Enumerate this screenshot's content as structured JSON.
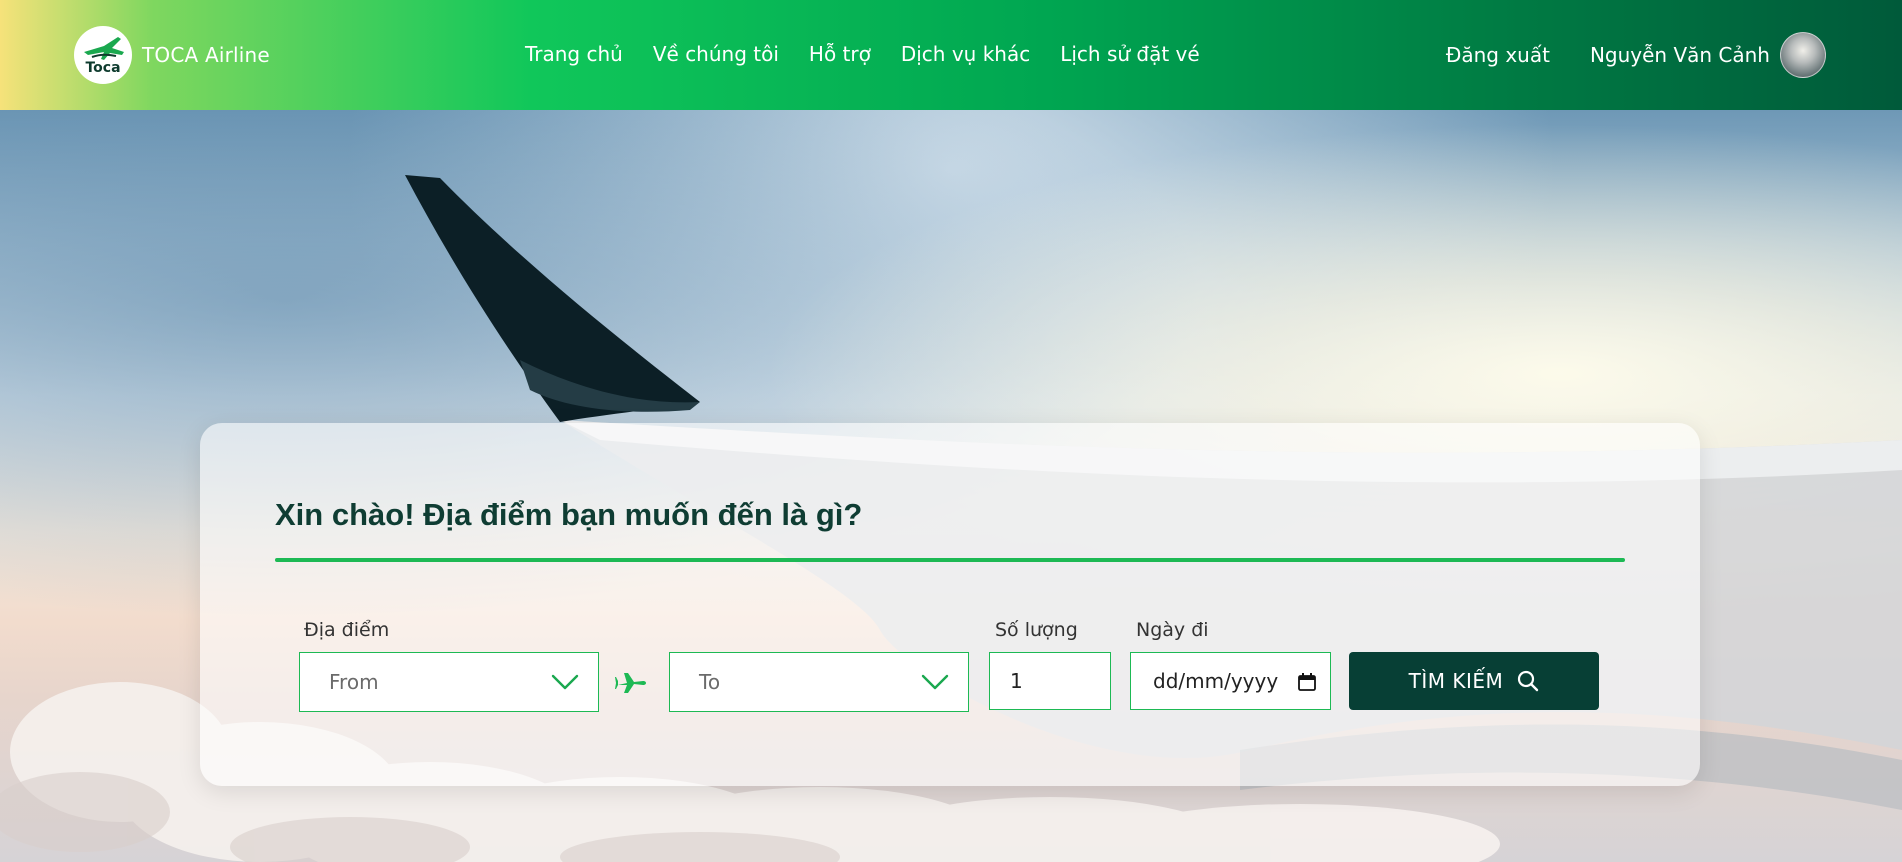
{
  "header": {
    "brand_name": "TOCA Airline",
    "logo_text": "Toca",
    "nav": [
      {
        "label": "Trang chủ"
      },
      {
        "label": "Về chúng tôi"
      },
      {
        "label": "Hỗ trợ"
      },
      {
        "label": "Dịch vụ khác"
      },
      {
        "label": "Lịch sử đặt vé"
      }
    ],
    "logout_label": "Đăng xuất",
    "username": "Nguyễn Văn Cảnh"
  },
  "search": {
    "title": "Xin chào! Địa điểm bạn muốn đến là gì?",
    "location_label": "Địa điểm",
    "from_placeholder": "From",
    "to_placeholder": "To",
    "quantity_label": "Số lượng",
    "quantity_value": "1",
    "date_label": "Ngày đi",
    "date_placeholder": "dd/mm/yyyy",
    "search_button_label": "TÌM KIẾM"
  },
  "colors": {
    "accent": "#1db954",
    "button_dark": "#073f35",
    "title_text": "#0f3d33"
  },
  "icons": {
    "logo": "toca-plane-logo-icon",
    "chevron": "chevron-down-icon",
    "swap": "plane-icon",
    "calendar": "calendar-icon",
    "search": "search-icon"
  }
}
